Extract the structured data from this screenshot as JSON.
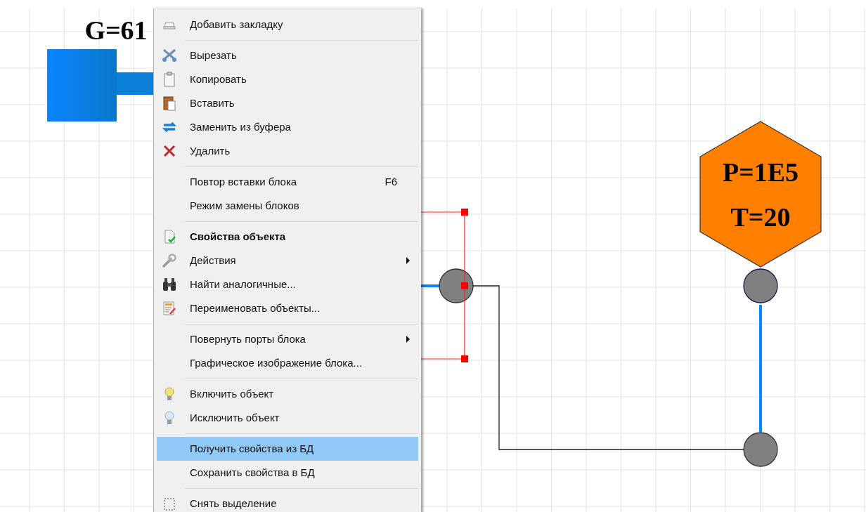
{
  "canvas": {
    "labels": [
      {
        "text": "G=61"
      },
      {
        "text": "P=1E5"
      },
      {
        "text": "T=20"
      }
    ]
  },
  "context_menu": {
    "items": [
      {
        "kind": "item",
        "label": "Добавить закладку",
        "selected": false
      },
      {
        "kind": "separator"
      },
      {
        "kind": "item",
        "label": "Вырезать",
        "selected": false
      },
      {
        "kind": "item",
        "label": "Копировать",
        "selected": false
      },
      {
        "kind": "item",
        "label": "Вставить",
        "selected": false
      },
      {
        "kind": "item",
        "label": "Заменить из буфера",
        "selected": false
      },
      {
        "kind": "item",
        "label": "Удалить",
        "selected": false
      },
      {
        "kind": "separator"
      },
      {
        "kind": "item",
        "label": "Повтор вставки блока",
        "shortcut": "F6",
        "selected": false
      },
      {
        "kind": "item",
        "label": "Режим замены блоков",
        "selected": false
      },
      {
        "kind": "separator"
      },
      {
        "kind": "item",
        "label": "Свойства объекта",
        "default": true,
        "selected": false
      },
      {
        "kind": "item",
        "label": "Действия",
        "submenu": true,
        "selected": false
      },
      {
        "kind": "item",
        "label": "Найти аналогичные...",
        "selected": false
      },
      {
        "kind": "item",
        "label": "Переименовать объекты...",
        "selected": false
      },
      {
        "kind": "separator"
      },
      {
        "kind": "item",
        "label": "Повернуть порты блока",
        "submenu": true,
        "selected": false
      },
      {
        "kind": "item",
        "label": "Графическое изображение блока...",
        "selected": false
      },
      {
        "kind": "separator"
      },
      {
        "kind": "item",
        "label": "Включить объект",
        "selected": false
      },
      {
        "kind": "item",
        "label": "Исключить объект",
        "selected": false
      },
      {
        "kind": "separator"
      },
      {
        "kind": "item",
        "label": "Получить свойства из БД",
        "selected": true
      },
      {
        "kind": "item",
        "label": "Сохранить свойства в БД",
        "selected": false
      },
      {
        "kind": "separator"
      },
      {
        "kind": "item",
        "label": "Снять выделение",
        "selected": false
      }
    ]
  }
}
